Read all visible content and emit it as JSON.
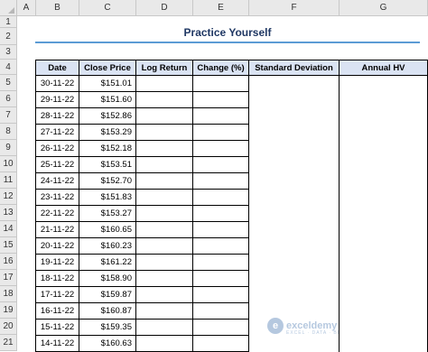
{
  "columns": [
    "A",
    "B",
    "C",
    "D",
    "E",
    "F",
    "G"
  ],
  "rows": [
    "1",
    "2",
    "3",
    "4",
    "5",
    "6",
    "7",
    "8",
    "9",
    "10",
    "11",
    "12",
    "13",
    "14",
    "15",
    "16",
    "17",
    "18",
    "19",
    "20",
    "21"
  ],
  "title": "Practice Yourself",
  "headers": {
    "date": "Date",
    "close_price": "Close Price",
    "log_return": "Log Return",
    "change": "Change (%)",
    "std_dev": "Standard Deviation",
    "annual_hv": "Annual HV"
  },
  "records": [
    {
      "date": "30-11-22",
      "price": "$151.01"
    },
    {
      "date": "29-11-22",
      "price": "$151.60"
    },
    {
      "date": "28-11-22",
      "price": "$152.86"
    },
    {
      "date": "27-11-22",
      "price": "$153.29"
    },
    {
      "date": "26-11-22",
      "price": "$152.18"
    },
    {
      "date": "25-11-22",
      "price": "$153.51"
    },
    {
      "date": "24-11-22",
      "price": "$152.70"
    },
    {
      "date": "23-11-22",
      "price": "$151.83"
    },
    {
      "date": "22-11-22",
      "price": "$153.27"
    },
    {
      "date": "21-11-22",
      "price": "$160.65"
    },
    {
      "date": "20-11-22",
      "price": "$160.23"
    },
    {
      "date": "19-11-22",
      "price": "$161.22"
    },
    {
      "date": "18-11-22",
      "price": "$158.90"
    },
    {
      "date": "17-11-22",
      "price": "$159.87"
    },
    {
      "date": "16-11-22",
      "price": "$160.87"
    },
    {
      "date": "15-11-22",
      "price": "$159.35"
    },
    {
      "date": "14-11-22",
      "price": "$160.63"
    }
  ],
  "watermark": {
    "brand": "exceldemy",
    "tagline": "EXCEL · DATA · BI",
    "logo": "exceldemy-logo-icon"
  }
}
